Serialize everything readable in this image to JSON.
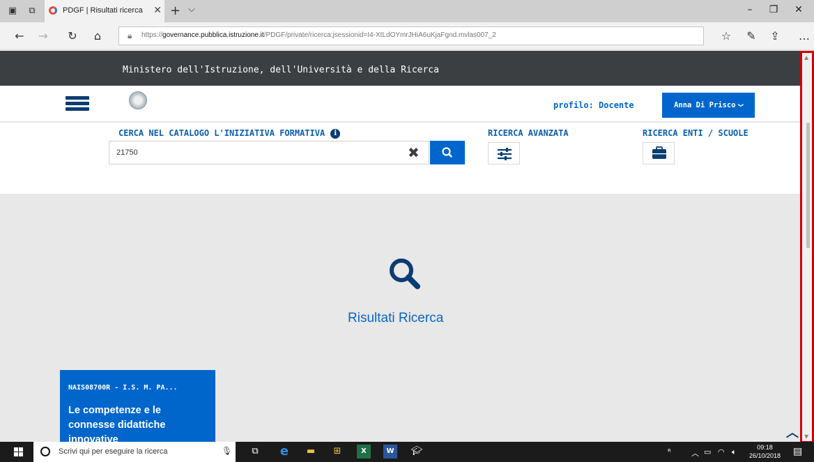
{
  "browser": {
    "tab_title": "PDGF | Risultati ricerca",
    "tab_close": "✕",
    "new_tab": "+",
    "tab_menu": "⌵",
    "url_prefix": "https://",
    "url_domain": "governance.pubblica.istruzione.it",
    "url_path": "/PDGF/private/ricerca;jsessionid=I4-XtLdOYmrJHiA6uKjaFgnd.mvlas007_2"
  },
  "site": {
    "ministry": "Ministero dell'Istruzione, dell'Università e della Ricerca",
    "profile": "profilo: Docente",
    "user_name": "Anna Di Prisco",
    "user_chevron": "❯"
  },
  "search": {
    "label": "CERCA NEL CATALOGO L'INIZIATIVA FORMATIVA",
    "info_glyph": "i",
    "value": "21750",
    "clear_glyph": "✖",
    "advanced_label": "RICERCA AVANZATA",
    "entities_label": "RICERCA ENTI / SCUOLE"
  },
  "results": {
    "title": "Risultati Ricerca",
    "card": {
      "code": "NAIS08700R - I.S. M. PA...",
      "title": "Le competenze e le connesse didattiche innovative"
    }
  },
  "taskbar": {
    "search_placeholder": "Scrivi qui per eseguire la ricerca",
    "time": "09:18",
    "date": "26/10/2018"
  },
  "colors": {
    "accent": "#0066cc",
    "ministry_bar": "#3c3f42",
    "frame": "#d00000"
  }
}
